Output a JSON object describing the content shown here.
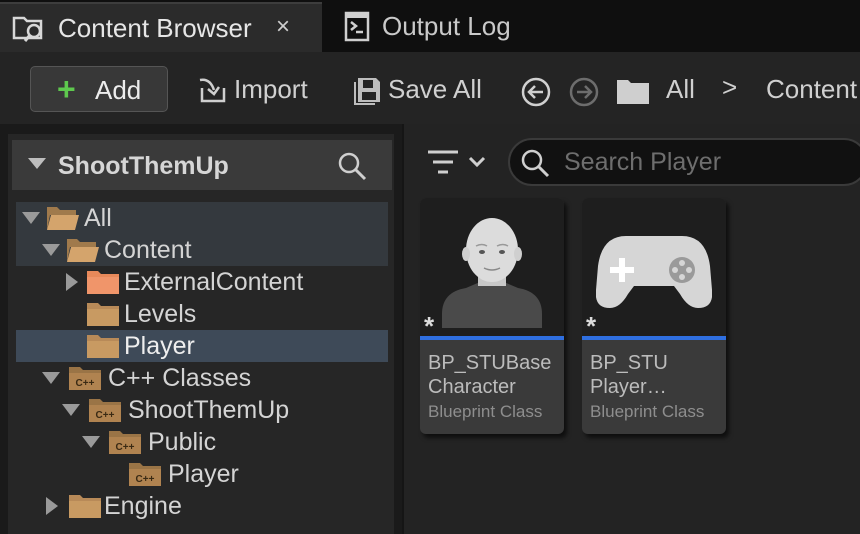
{
  "tabs": [
    {
      "label": "Content Browser",
      "icon": "content-browser-icon",
      "active": true,
      "close": "×"
    },
    {
      "label": "Output Log",
      "icon": "output-log-icon",
      "active": false
    }
  ],
  "toolbar": {
    "add_label": "Add",
    "import_label": "Import",
    "save_all_label": "Save All",
    "breadcrumb": [
      "All",
      "Content"
    ],
    "breadcrumb_separator": ">"
  },
  "sources": {
    "title": "ShootThemUp",
    "tree": [
      {
        "label": "All",
        "icon": "folder-open-icon"
      },
      {
        "label": "Content",
        "icon": "folder-open-icon"
      },
      {
        "label": "ExternalContent",
        "icon": "folder-icon"
      },
      {
        "label": "Levels",
        "icon": "folder-icon"
      },
      {
        "label": "Player",
        "icon": "folder-icon",
        "selected": true
      },
      {
        "label": "C++ Classes",
        "icon": "cpp-folder-icon"
      },
      {
        "label": "ShootThemUp",
        "icon": "cpp-folder-icon"
      },
      {
        "label": "Public",
        "icon": "cpp-folder-icon"
      },
      {
        "label": "Player",
        "icon": "cpp-folder-icon"
      },
      {
        "label": "Engine",
        "icon": "folder-icon"
      }
    ]
  },
  "search": {
    "placeholder": "Search Player",
    "value": ""
  },
  "assets": [
    {
      "name_line1": "BP_STUBase",
      "name_line2": "Character",
      "type": "Blueprint Class",
      "icon": "character-icon",
      "badge": "*"
    },
    {
      "name_line1": "BP_STU",
      "name_line2": "Player…",
      "type": "Blueprint Class",
      "icon": "gamepad-icon",
      "badge": "*"
    }
  ],
  "colors": {
    "accent_blue": "#2f6fe0",
    "add_green": "#5ec84e",
    "folder": "#c89a62",
    "folder_external": "#e8895a",
    "selection": "#3e4a58"
  }
}
